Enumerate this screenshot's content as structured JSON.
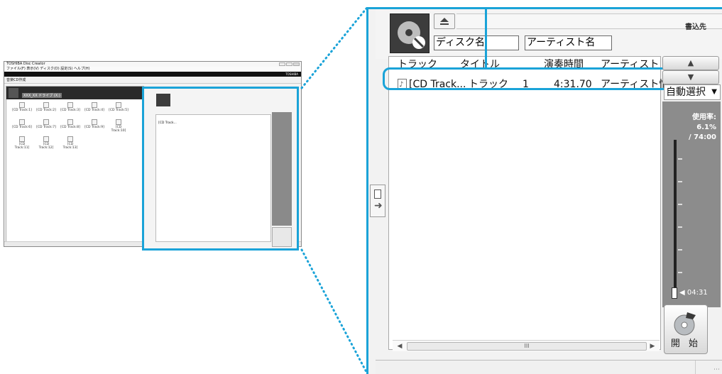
{
  "thumbnail": {
    "title": "TOSHIBA Disc Creator",
    "menu": "ファイル(F)  表示(V)  ディスク(D)  設定(S)  ヘルプ(H)",
    "brand": "TOSHIBA",
    "toolbar_mode": "音楽CD作成",
    "drive": "XXX_XX ドライブ (X:)",
    "tracks": [
      "[CD Track:1]",
      "[CD Track:2]",
      "[CD Track:3]",
      "[CD Track:4]",
      "[CD Track:5]",
      "[CD Track:6]",
      "[CD Track:7]",
      "[CD Track:8]",
      "[CD Track:9]",
      "[CD Track:10]",
      "[CD Track:11]",
      "[CD Track:12]",
      "[CD Track:13]"
    ]
  },
  "panel": {
    "writer_label": "書込先",
    "disc_name": "ディスク名",
    "artist_name": "アーティスト名",
    "columns": {
      "track": "トラック",
      "title": "タイトル",
      "duration": "演奏時間",
      "artist": "アーティスト"
    },
    "row": {
      "track": "[CD Track...",
      "title": "トラック",
      "number": "1",
      "duration": "4:31.70",
      "artist": "アーティスト情報"
    },
    "sort_mode": "自動選択",
    "usage_label": "使用率:",
    "usage_percent": "6.1%",
    "usage_total": "/ 74:00",
    "usage_fraction": 0.061,
    "elapsed": "04:31",
    "start_label": "開 始",
    "scroll_thumb_label": "III"
  },
  "colors": {
    "highlight": "#1aa3d8",
    "gauge": "#8c8c8c"
  }
}
